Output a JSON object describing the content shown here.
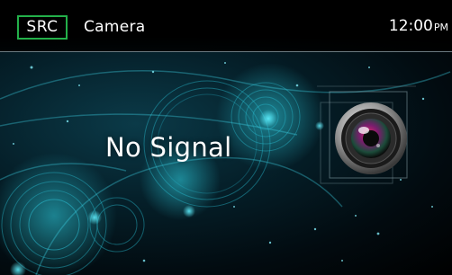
{
  "header": {
    "source_button_label": "SRC",
    "source_name": "Camera",
    "clock_time": "12:00",
    "clock_ampm": "PM"
  },
  "main": {
    "status_message": "No Signal",
    "source_icon": "camera-lens-icon"
  },
  "colors": {
    "accent_border": "#23b04a",
    "background": "#05202a",
    "glow": "#1fb5c8"
  }
}
